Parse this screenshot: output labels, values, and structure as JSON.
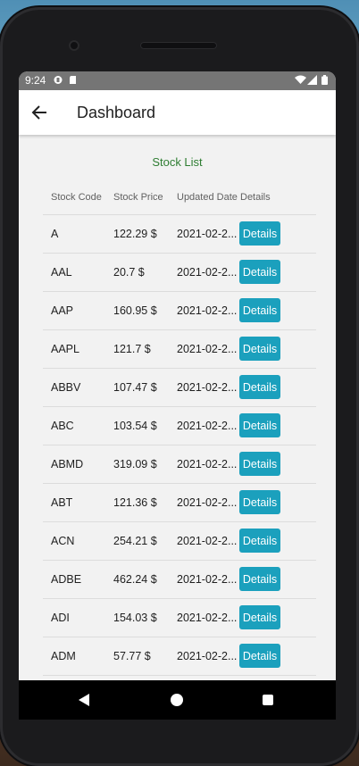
{
  "status_bar": {
    "time": "9:24"
  },
  "app_bar": {
    "title": "Dashboard"
  },
  "list_title": "Stock List",
  "table": {
    "headers": [
      "Stock Code",
      "Stock Price",
      "Updated Date",
      "Details"
    ],
    "rows": [
      {
        "code": "A",
        "price": "122.29 $",
        "date": "2021-02-2...",
        "action": "Details"
      },
      {
        "code": "AAL",
        "price": "20.7 $",
        "date": "2021-02-2...",
        "action": "Details"
      },
      {
        "code": "AAP",
        "price": "160.95 $",
        "date": "2021-02-2...",
        "action": "Details"
      },
      {
        "code": "AAPL",
        "price": "121.7 $",
        "date": "2021-02-2...",
        "action": "Details"
      },
      {
        "code": "ABBV",
        "price": "107.47 $",
        "date": "2021-02-2...",
        "action": "Details"
      },
      {
        "code": "ABC",
        "price": "103.54 $",
        "date": "2021-02-2...",
        "action": "Details"
      },
      {
        "code": "ABMD",
        "price": "319.09 $",
        "date": "2021-02-2...",
        "action": "Details"
      },
      {
        "code": "ABT",
        "price": "121.36 $",
        "date": "2021-02-2...",
        "action": "Details"
      },
      {
        "code": "ACN",
        "price": "254.21 $",
        "date": "2021-02-2...",
        "action": "Details"
      },
      {
        "code": "ADBE",
        "price": "462.24 $",
        "date": "2021-02-2...",
        "action": "Details"
      },
      {
        "code": "ADI",
        "price": "154.03 $",
        "date": "2021-02-2...",
        "action": "Details"
      },
      {
        "code": "ADM",
        "price": "57.77 $",
        "date": "2021-02-2...",
        "action": "Details"
      }
    ]
  },
  "colors": {
    "accent": "#1ba0bd",
    "list_title": "#2e7d32",
    "status_bar": "#757575"
  },
  "icons": [
    "back-arrow-icon",
    "wifi-icon",
    "signal-icon",
    "battery-icon",
    "nav-back-icon",
    "nav-home-icon",
    "nav-recents-icon"
  ]
}
